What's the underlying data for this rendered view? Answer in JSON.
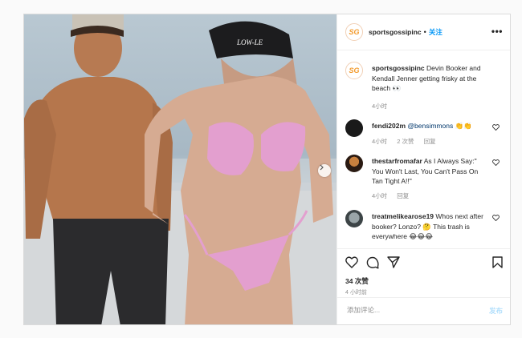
{
  "header": {
    "avatar_text": "SG",
    "username": "sportsgossipinc",
    "separator": "•",
    "follow_label": "关注",
    "more_label": "•••"
  },
  "media": {
    "cap_text": "LOW-LE",
    "next_icon": "chevron-right-icon"
  },
  "caption": {
    "username": "sportsgossipinc",
    "text": "Devin Booker and Kendall Jenner getting frisky at the beach 👀",
    "time": "4小时"
  },
  "comments": [
    {
      "username": "fendi202m",
      "mention": "@bensimmons",
      "text": " 👏👏",
      "time": "4小时",
      "likes": "2 次赞",
      "reply": "回复"
    },
    {
      "username": "thestarfromafar",
      "text": "As I Always Say:\" You Won't Last, You Can't Pass On Tan Tight A!!\"",
      "time": "4小时",
      "reply": "回复"
    },
    {
      "username": "treatmelikearose19",
      "text": "Whos next after booker? Lonzo? 🤔 This trash is everywhere 😂😂😂",
      "time": "",
      "reply": ""
    }
  ],
  "actions": {
    "likes": "34 次赞",
    "time": "4 小时前"
  },
  "add_comment": {
    "placeholder": "添加评论...",
    "post_label": "发布"
  },
  "colors": {
    "accent": "#0095f6",
    "post_disabled": "#b2dffc",
    "border": "#dbdbdb"
  }
}
